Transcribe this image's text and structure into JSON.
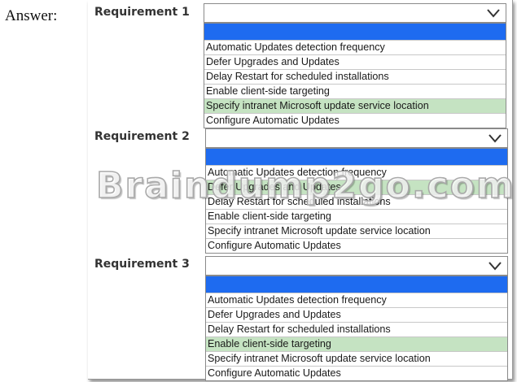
{
  "answer_label": "Answer:",
  "requirements": [
    {
      "label": "Requirement 1",
      "options": [
        "Automatic Updates detection frequency",
        "Defer Upgrades and Updates",
        "Delay Restart for scheduled installations",
        "Enable client-side targeting",
        "Specify intranet Microsoft update service location",
        "Configure Automatic Updates"
      ],
      "selected_option": "Specify intranet Microsoft update service location"
    },
    {
      "label": "Requirement 2",
      "options": [
        "Automatic Updates detection frequency",
        "Defer Upgrades and Updates",
        "Delay Restart for scheduled installations",
        "Enable client-side targeting",
        "Specify intranet Microsoft update service location",
        "Configure Automatic Updates"
      ],
      "selected_option": "Defer Upgrades and Updates"
    },
    {
      "label": "Requirement 3",
      "options": [
        "Automatic Updates detection frequency",
        "Defer Upgrades and Updates",
        "Delay Restart for scheduled installations",
        "Enable client-side targeting",
        "Specify intranet Microsoft update service location",
        "Configure Automatic Updates"
      ],
      "selected_option": "Enable client-side targeting"
    }
  ],
  "watermark": "Braindump2go.com",
  "colors": {
    "list_header": "#1e6bf0",
    "selected_row": "#c5e3c2"
  },
  "icons": {
    "dropdown": "chevron-down-icon"
  }
}
